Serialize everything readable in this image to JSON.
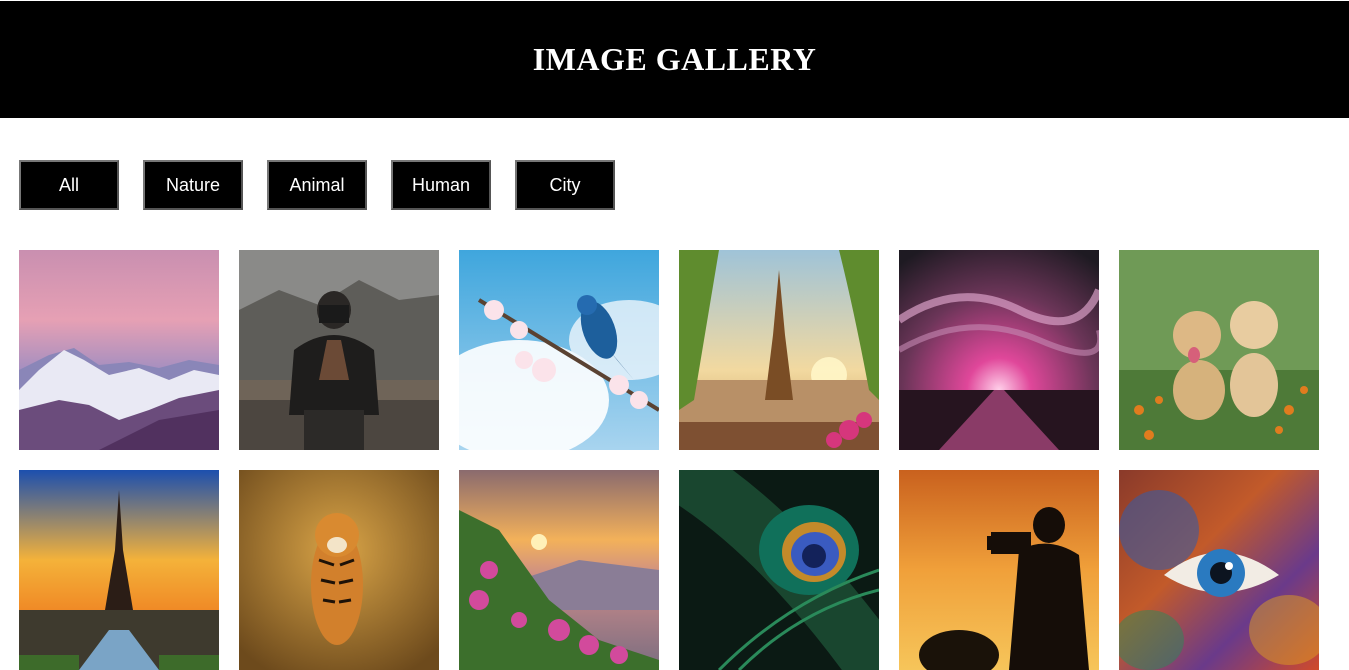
{
  "header": {
    "title": "IMAGE GALLERY"
  },
  "filters": [
    {
      "label": "All"
    },
    {
      "label": "Nature"
    },
    {
      "label": "Animal"
    },
    {
      "label": "Human"
    },
    {
      "label": "City"
    }
  ],
  "gallery": {
    "images": [
      {
        "subject": "snowy mountains at pink sunset",
        "category": "Nature"
      },
      {
        "subject": "photographer with camera in mountains",
        "category": "Human"
      },
      {
        "subject": "blue bird on cherry blossom branch",
        "category": "Animal"
      },
      {
        "subject": "Eiffel Tower framed by leaves at sunset",
        "category": "City"
      },
      {
        "subject": "pink sky over road at dusk",
        "category": "Nature"
      },
      {
        "subject": "two golden retriever puppies in flowers",
        "category": "Animal"
      },
      {
        "subject": "Eiffel Tower at sunrise",
        "category": "City"
      },
      {
        "subject": "tiger walking in golden grass",
        "category": "Animal"
      },
      {
        "subject": "valley with pink flowers at sunset",
        "category": "Nature"
      },
      {
        "subject": "peacock feather close-up",
        "category": "Nature"
      },
      {
        "subject": "silhouette of photographer at sunset",
        "category": "Human"
      },
      {
        "subject": "eye with colorful powder paint",
        "category": "Human"
      }
    ]
  },
  "colors": {
    "header_bg": "#000000",
    "header_text": "#ffffff",
    "button_bg": "#000000",
    "button_text": "#ffffff",
    "page_bg": "#ffffff"
  }
}
